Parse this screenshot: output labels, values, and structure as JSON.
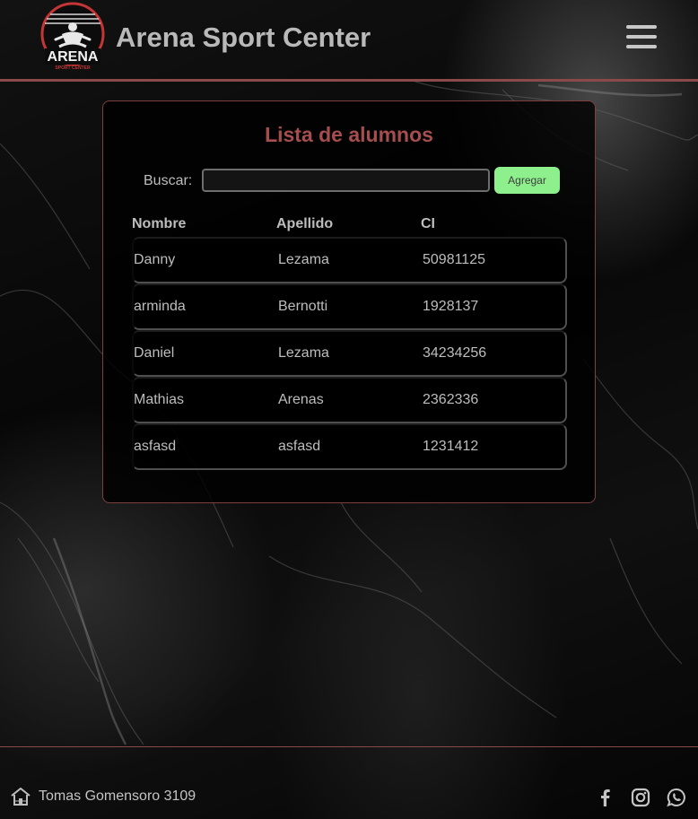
{
  "header": {
    "logo_text": "ARENA",
    "logo_subtext": "SPORT CENTER",
    "title": "Arena Sport Center",
    "menu_icon": "hamburger-menu-icon"
  },
  "panel": {
    "title": "Lista de alumnos",
    "search": {
      "label": "Buscar:",
      "value": "",
      "placeholder": ""
    },
    "add_button_label": "Agregar",
    "columns": [
      "Nombre",
      "Apellido",
      "CI"
    ],
    "rows": [
      {
        "nombre": "Danny",
        "apellido": "Lezama",
        "ci": "50981125"
      },
      {
        "nombre": "arminda",
        "apellido": "Bernotti",
        "ci": "1928137"
      },
      {
        "nombre": "Daniel",
        "apellido": "Lezama",
        "ci": "34234256"
      },
      {
        "nombre": "Mathias",
        "apellido": "Arenas",
        "ci": "2362336"
      },
      {
        "nombre": "asfasd",
        "apellido": "asfasd",
        "ci": "1231412"
      }
    ]
  },
  "footer": {
    "address_icon": "home-icon",
    "address": "Tomas Gomensoro 3109",
    "social_icons": [
      "facebook-icon",
      "instagram-icon",
      "whatsapp-icon"
    ]
  },
  "colors": {
    "accent": "#a64e4e",
    "divider": "#8b4a4a",
    "add_button": "#8ef08c",
    "text": "#bdbdbd"
  }
}
